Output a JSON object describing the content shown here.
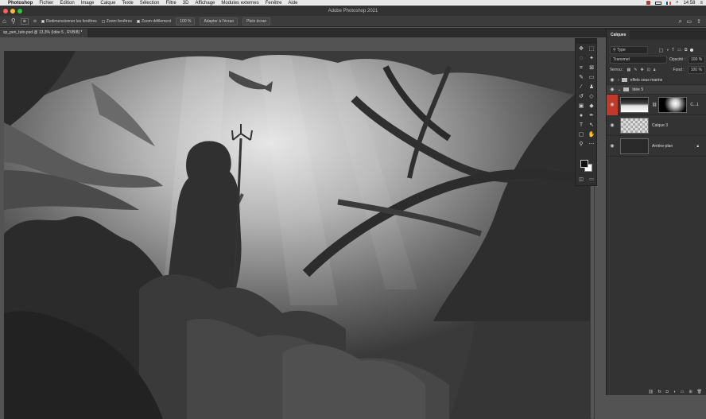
{
  "menubar": {
    "app": "Photoshop",
    "items": [
      "Fichier",
      "Edition",
      "Image",
      "Calque",
      "Texte",
      "Sélection",
      "Filtre",
      "3D",
      "Affichage",
      "Modules externes",
      "Fenêtre",
      "Aide"
    ],
    "clock": "14:58"
  },
  "window": {
    "title": "Adobe Photoshop 2021"
  },
  "options": {
    "check_resize": "Redimensionner les fenêtres",
    "check_all": "Zoom fenêtres",
    "check_scrubby": "Zoom défilement",
    "zoom_value": "100 %",
    "fit_button": "Adapter à l'écran",
    "fill_button": "Plein écran"
  },
  "document": {
    "tab_label": "sp_pen_tuto.psd @ 13,3% (Idée 5 , RVB/8) *"
  },
  "layers_panel": {
    "tab": "Calques",
    "filter_label": "Type",
    "blend_mode": "Transmet",
    "opacity_label": "Opacité :",
    "opacity_value": "100 %",
    "lock_label": "Verrou :",
    "fill_label": "Fond :",
    "fill_value": "100 %",
    "layers": [
      {
        "name": "effets sous marins",
        "type": "group"
      },
      {
        "name": "Idée 5",
        "type": "group"
      },
      {
        "name": "C...1",
        "type": "masked"
      },
      {
        "name": "Calque 3",
        "type": "transparent"
      },
      {
        "name": "Arrière-plan",
        "type": "background"
      }
    ]
  },
  "colors": {
    "accent_red": "#c0392b",
    "panel": "#333333",
    "canvas_bg": "#535353"
  },
  "icons": [
    "move-icon",
    "marquee-icon",
    "lasso-icon",
    "magic-wand-icon",
    "crop-icon",
    "frame-icon",
    "eyedropper-icon",
    "spot-heal-icon",
    "brush-icon",
    "stamp-icon",
    "history-brush-icon",
    "eraser-icon",
    "gradient-icon",
    "blur-icon",
    "dodge-icon",
    "pen-icon",
    "type-icon",
    "path-select-icon",
    "shape-icon",
    "hand-icon",
    "zoom-icon",
    "more-icon"
  ]
}
